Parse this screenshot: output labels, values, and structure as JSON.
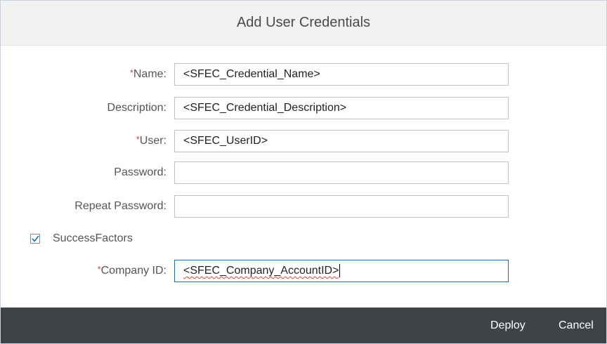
{
  "dialog": {
    "title": "Add User Credentials",
    "fields": {
      "name": {
        "required_mark": "*",
        "label": "Name:",
        "value": "<SFEC_Credential_Name>"
      },
      "description": {
        "required_mark": "",
        "label": "Description:",
        "value": "<SFEC_Credential_Description>"
      },
      "user": {
        "required_mark": "*",
        "label": "User:",
        "value": "<SFEC_UserID>"
      },
      "password": {
        "required_mark": "",
        "label": "Password:",
        "value": ""
      },
      "repeat_password": {
        "required_mark": "",
        "label": "Repeat Password:",
        "value": ""
      },
      "company_id": {
        "required_mark": "*",
        "label": "Company ID:",
        "value": "<SFEC_Company_AccountID>"
      }
    },
    "successfactors": {
      "label": "SuccessFactors",
      "checked": true,
      "icon": "checkmark-icon"
    },
    "footer": {
      "deploy_label": "Deploy",
      "cancel_label": "Cancel"
    }
  },
  "colors": {
    "header_bg": "#f2f2f2",
    "footer_bg": "#3f4347",
    "required_mark": "#c14646",
    "focus_border": "#1b6fb0",
    "checkmark": "#1b6fb0"
  }
}
